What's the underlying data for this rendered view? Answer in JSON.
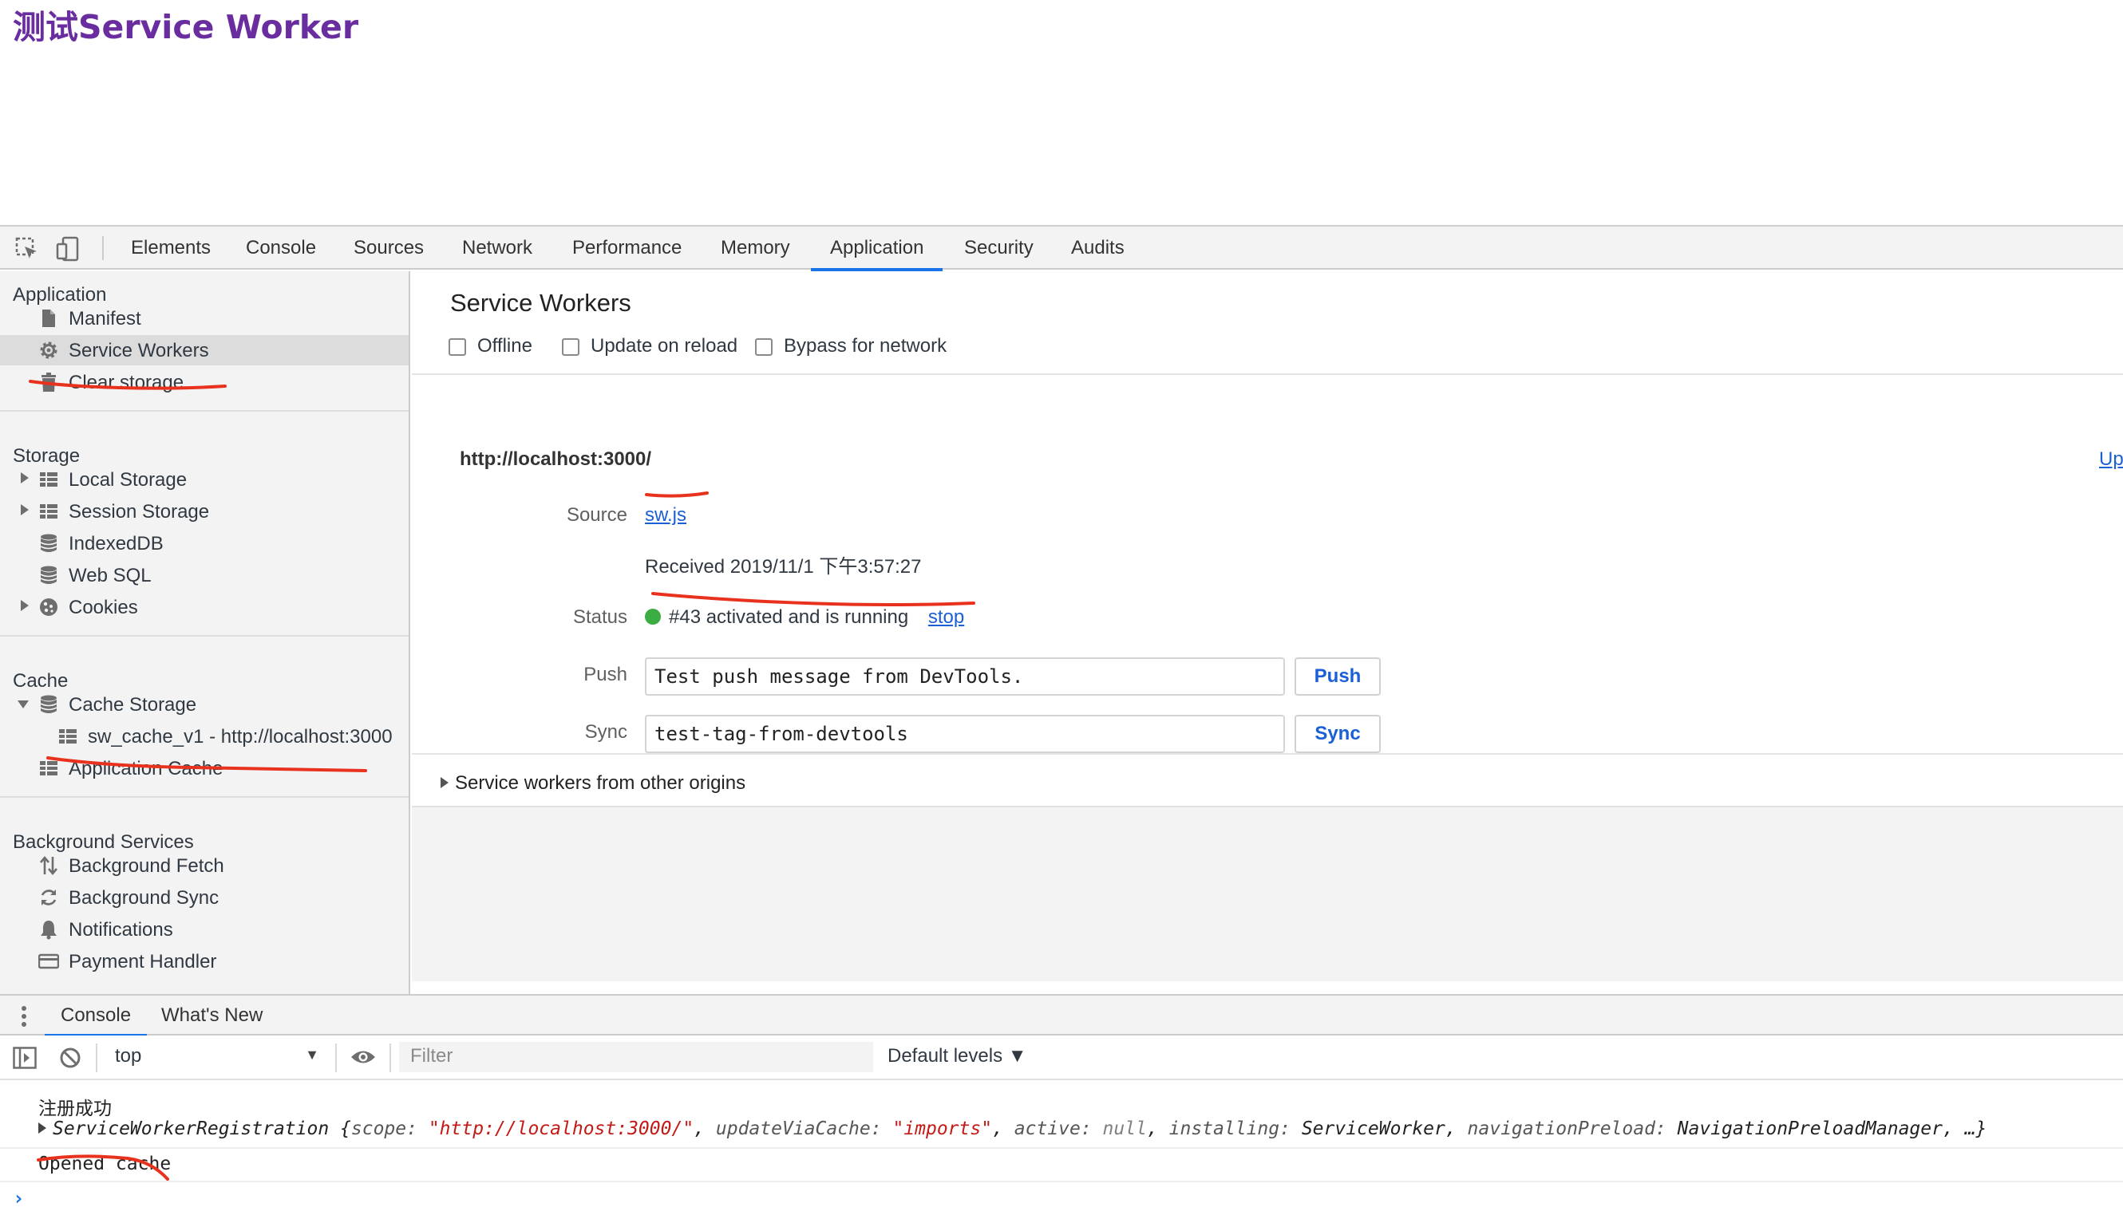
{
  "page": {
    "heading": "测试Service Worker"
  },
  "devtools": {
    "tabs": [
      "Elements",
      "Console",
      "Sources",
      "Network",
      "Performance",
      "Memory",
      "Application",
      "Security",
      "Audits"
    ],
    "active_tab": "Application",
    "accent_color": "#1a73e8",
    "sidebar": {
      "sections": [
        {
          "title": "Application",
          "items": [
            {
              "label": "Manifest",
              "icon": "file-icon"
            },
            {
              "label": "Service Workers",
              "icon": "gear-icon",
              "selected": true
            },
            {
              "label": "Clear storage",
              "icon": "trash-icon"
            }
          ]
        },
        {
          "title": "Storage",
          "items": [
            {
              "label": "Local Storage",
              "icon": "grid-icon",
              "expandable": true
            },
            {
              "label": "Session Storage",
              "icon": "grid-icon",
              "expandable": true
            },
            {
              "label": "IndexedDB",
              "icon": "database-icon"
            },
            {
              "label": "Web SQL",
              "icon": "database-icon"
            },
            {
              "label": "Cookies",
              "icon": "cookie-icon",
              "expandable": true
            }
          ]
        },
        {
          "title": "Cache",
          "items": [
            {
              "label": "Cache Storage",
              "icon": "database-icon",
              "expanded": true
            },
            {
              "label": "sw_cache_v1 - http://localhost:3000",
              "icon": "grid-icon",
              "child": true
            },
            {
              "label": "Application Cache",
              "icon": "grid-icon"
            }
          ]
        },
        {
          "title": "Background Services",
          "items": [
            {
              "label": "Background Fetch",
              "icon": "up-down-arrows-icon"
            },
            {
              "label": "Background Sync",
              "icon": "sync-icon"
            },
            {
              "label": "Notifications",
              "icon": "bell-icon"
            },
            {
              "label": "Payment Handler",
              "icon": "card-icon"
            }
          ]
        }
      ]
    },
    "service_workers": {
      "title": "Service Workers",
      "options": [
        {
          "label": "Offline",
          "checked": false
        },
        {
          "label": "Update on reload",
          "checked": false
        },
        {
          "label": "Bypass for network",
          "checked": false
        }
      ],
      "origin": "http://localhost:3000/",
      "update_link": "Up",
      "source_label": "Source",
      "source_file": "sw.js",
      "received": "Received 2019/11/1 下午3:57:27",
      "status_label": "Status",
      "status_text": "#43 activated and is running",
      "status_color": "#3bad42",
      "stop_link": "stop",
      "push_label": "Push",
      "push_value": "Test push message from DevTools.",
      "push_button": "Push",
      "sync_label": "Sync",
      "sync_value": "test-tag-from-devtools",
      "sync_button": "Sync",
      "other_origins": "Service workers from other origins"
    },
    "drawer": {
      "tabs": [
        "Console",
        "What's New"
      ],
      "active_tab": "Console",
      "context": "top",
      "filter_placeholder": "Filter",
      "levels": "Default levels ▼",
      "messages": {
        "line1": "注册成功",
        "obj_name": "ServiceWorkerRegistration",
        "k_scope": "scope: ",
        "v_scope": "\"http://localhost:3000/\"",
        "k_update": "updateViaCache: ",
        "v_update": "\"imports\"",
        "k_active": "active: ",
        "v_active": "null",
        "k_installing": "installing: ",
        "v_installing": "ServiceWorker",
        "k_preload": "navigationPreload: ",
        "v_preload": "NavigationPreloadManager",
        "tail": "…}",
        "line3": "Opened cache"
      },
      "prompt": "›"
    },
    "annotation_color": "#e8321e"
  }
}
